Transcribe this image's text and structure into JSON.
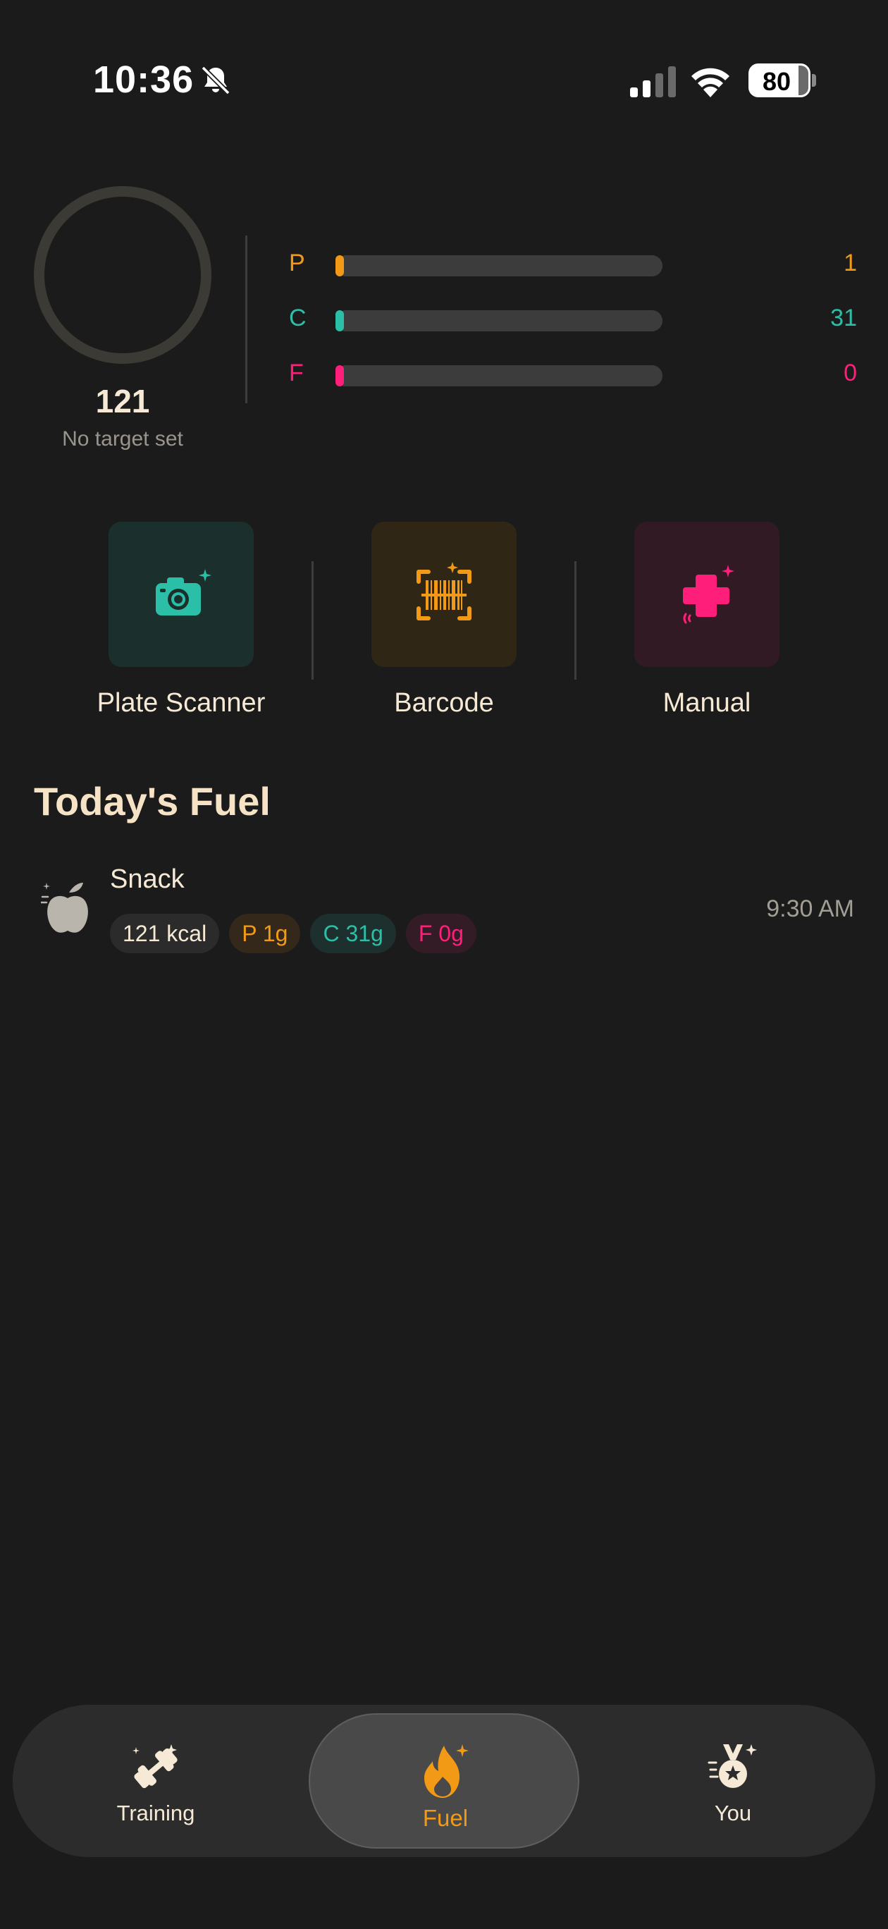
{
  "status_bar": {
    "time": "10:36",
    "battery": "80",
    "icons": [
      "bell-slash-icon",
      "cellular-signal-icon",
      "wifi-icon",
      "battery-icon"
    ]
  },
  "summary": {
    "calories": "121",
    "calorie_note": "No target set",
    "macros": [
      {
        "letter": "P",
        "value": "1",
        "progress": 0.01,
        "color": "#f29a16"
      },
      {
        "letter": "C",
        "value": "31",
        "progress": 0.02,
        "color": "#2bbfa8"
      },
      {
        "letter": "F",
        "value": "0",
        "progress": 0.0,
        "color": "#ff1f7a"
      }
    ]
  },
  "actions": [
    {
      "label": "Plate Scanner",
      "icon": "camera-sparkle-icon",
      "color": "#2bbfa8",
      "bg": "#1b302d"
    },
    {
      "label": "Barcode",
      "icon": "barcode-scan-icon",
      "color": "#f29a16",
      "bg": "#302616"
    },
    {
      "label": "Manual",
      "icon": "plus-sparkle-icon",
      "color": "#ff1f7a",
      "bg": "#321a24"
    }
  ],
  "fuel_section": {
    "title": "Today's Fuel",
    "meals": [
      {
        "name": "Snack",
        "icon": "apple-icon",
        "time": "9:30 AM",
        "tags": {
          "kcal": "121 kcal",
          "protein": "P 1g",
          "carbs": "C 31g",
          "fat": "F 0g"
        }
      }
    ]
  },
  "tab_bar": {
    "tabs": [
      {
        "label": "Training",
        "icon": "dumbbell-icon"
      },
      {
        "label": "Fuel",
        "icon": "flame-icon",
        "active": true
      },
      {
        "label": "You",
        "icon": "medal-icon"
      }
    ]
  }
}
